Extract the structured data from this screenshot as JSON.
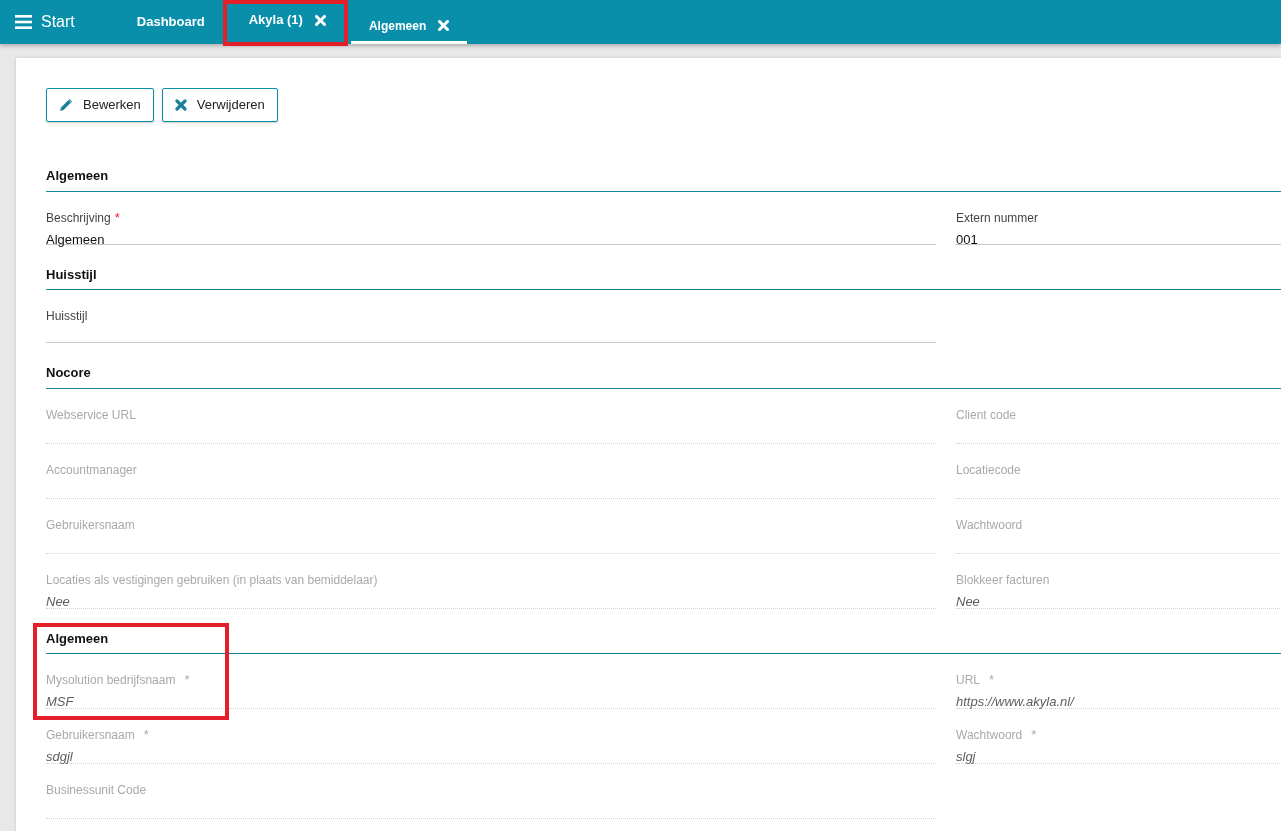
{
  "navbar": {
    "menu_label": "Start",
    "tabs": [
      {
        "label": "Dashboard",
        "closable": false,
        "selected": false,
        "highlighted": false
      },
      {
        "label": "Akyla (1)",
        "closable": true,
        "selected": false,
        "highlighted": true
      },
      {
        "label": "Algemeen",
        "closable": true,
        "selected": true,
        "highlighted": false
      }
    ]
  },
  "toolbar": [
    {
      "label": "Bewerken",
      "kind": "edit"
    },
    {
      "label": "Verwijderen",
      "kind": "delete"
    }
  ],
  "sections": [
    {
      "title": "Algemeen",
      "highlighted": false,
      "rows": [
        {
          "left": {
            "label": "Beschrijving",
            "required_mark": "*",
            "value": "Algemeen",
            "disabled": false
          },
          "right": {
            "label": "Extern nummer",
            "value": "001",
            "disabled": false
          }
        }
      ]
    },
    {
      "title": "Huisstijl",
      "highlighted": false,
      "rows": [
        {
          "left": {
            "label": "Huisstijl",
            "disabled": false
          },
          "right": null
        }
      ]
    },
    {
      "title": "Nocore",
      "highlighted": false,
      "rows": [
        {
          "left": {
            "label": "Webservice URL",
            "disabled": true
          },
          "right": {
            "label": "Client code",
            "disabled": true
          }
        },
        {
          "left": {
            "label": "Accountmanager",
            "disabled": true
          },
          "right": {
            "label": "Locatiecode",
            "disabled": true
          }
        },
        {
          "left": {
            "label": "Gebruikersnaam",
            "disabled": true
          },
          "right": {
            "label": "Wachtwoord",
            "disabled": true
          }
        },
        {
          "left": {
            "label": "Locaties als vestigingen gebruiken (in plaats van bemiddelaar)",
            "value": "Nee",
            "disabled": true
          },
          "right": {
            "label": "Blokkeer facturen",
            "value": "Nee",
            "disabled": true
          }
        }
      ]
    },
    {
      "title": "Algemeen",
      "highlighted": true,
      "rows": [
        {
          "left": {
            "label": "Mysolution bedrijfsnaam",
            "required_mark": "*",
            "value": "MSF",
            "disabled": true
          },
          "right": {
            "label": "URL",
            "required_mark": "*",
            "value": "https://www.akyla.nl/",
            "disabled": true
          }
        },
        {
          "left": {
            "label": "Gebruikersnaam",
            "required_mark": "*",
            "value": "sdgjl",
            "disabled": true
          },
          "right": {
            "label": "Wachtwoord",
            "required_mark": "*",
            "value": "slgj",
            "disabled": true
          }
        },
        {
          "left": {
            "label": "Businessunit Code",
            "disabled": true
          },
          "right": null
        }
      ]
    }
  ]
}
